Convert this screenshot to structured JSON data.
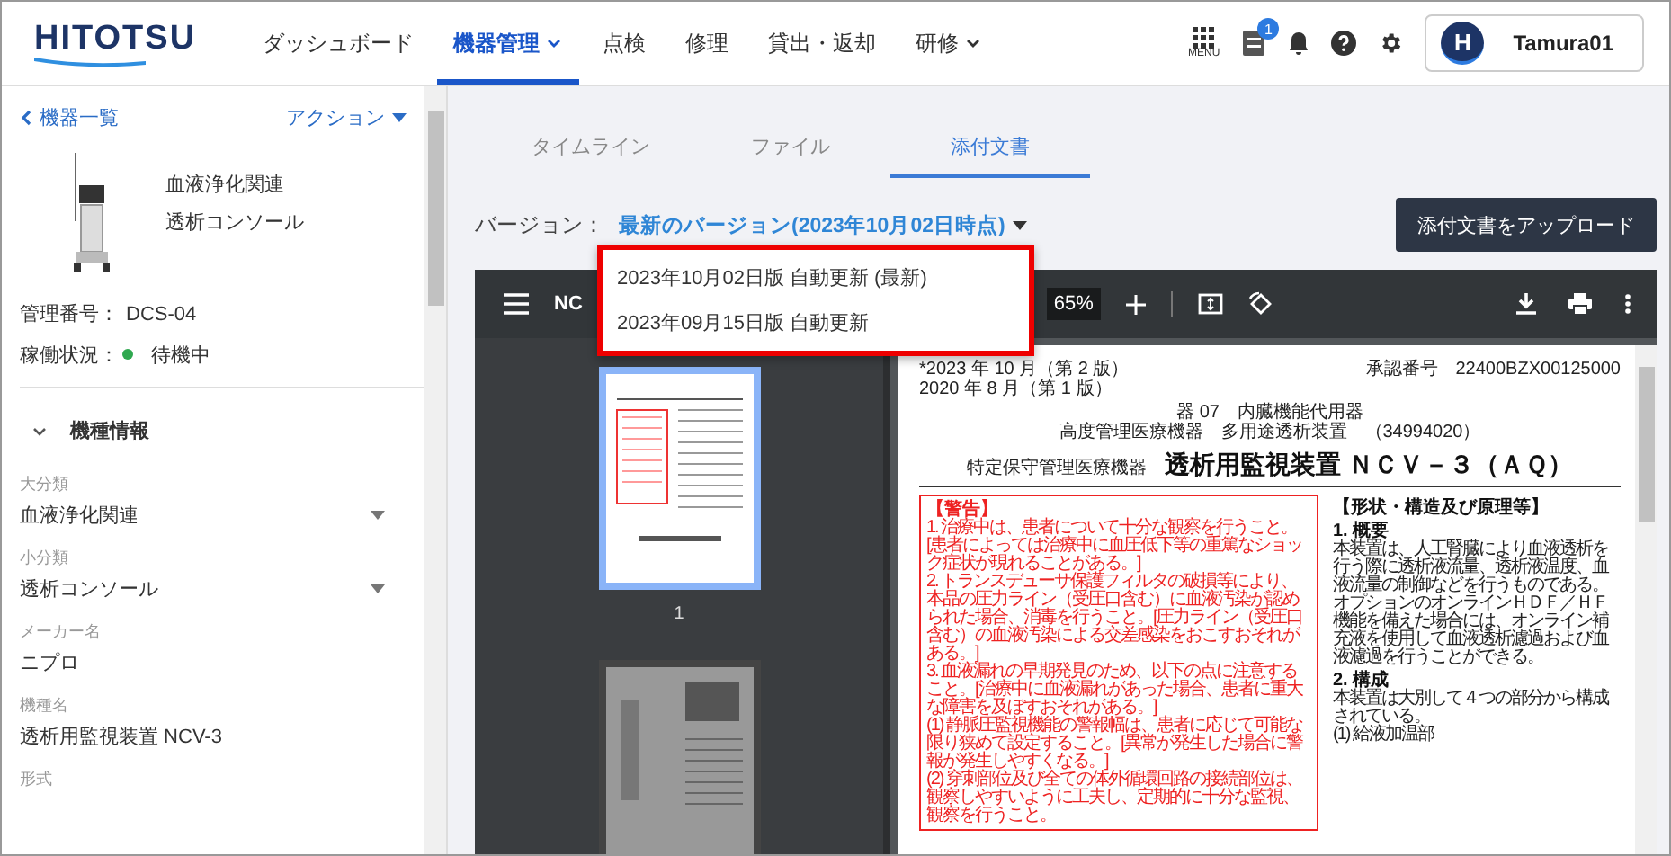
{
  "header": {
    "logo": "HITOTSU",
    "nav": [
      {
        "label": "ダッシュボード",
        "selected": false,
        "dropdown": false
      },
      {
        "label": "機器管理",
        "selected": true,
        "dropdown": true
      },
      {
        "label": "点検",
        "selected": false,
        "dropdown": false
      },
      {
        "label": "修理",
        "selected": false,
        "dropdown": false
      },
      {
        "label": "貸出・返却",
        "selected": false,
        "dropdown": false
      },
      {
        "label": "研修",
        "selected": false,
        "dropdown": true
      }
    ],
    "menu_label": "MENU",
    "notification_badge": "1",
    "user": {
      "initial": "H",
      "name": "Tamura01"
    }
  },
  "sidebar": {
    "back_link": "機器一覧",
    "action": "アクション",
    "device": {
      "category": "血液浄化関連",
      "type": "透析コンソール"
    },
    "info": [
      {
        "label": "管理番号：",
        "value": "DCS-04"
      },
      {
        "label": "稼働状況：",
        "value": "待機中",
        "color": "#2fa84f"
      }
    ],
    "section": {
      "title": "機種情報",
      "expanded": true
    },
    "fields": [
      {
        "kind": "select",
        "label": "大分類",
        "value": "血液浄化関連"
      },
      {
        "kind": "select",
        "label": "小分類",
        "value": "透析コンソール"
      },
      {
        "kind": "text",
        "label": "メーカー名",
        "value": "ニプロ"
      },
      {
        "kind": "text",
        "label": "機種名",
        "value": "透析用監視装置 NCV-3"
      },
      {
        "kind": "text",
        "label": "形式"
      }
    ]
  },
  "tabs": [
    {
      "label": "タイムライン",
      "selected": false
    },
    {
      "label": "ファイル",
      "selected": false
    },
    {
      "label": "添付文書",
      "selected": true
    }
  ],
  "version": {
    "label": "バージョン：",
    "value": "最新のバージョン(2023年10月02日時点)",
    "options": [
      "2023年10月02日版 自動更新 (最新)",
      "2023年09月15日版 自動更新"
    ]
  },
  "upload_button": "添付文書をアップロード",
  "viewer": {
    "title": "NC",
    "zoom": "65%",
    "thumbnails": [
      {
        "label": "1",
        "selected": true
      },
      {
        "selected": false
      }
    ],
    "page": {
      "revision": [
        "*2023 年 10 月（第 2 版）",
        "2020 年 8 月（第 1 版）"
      ],
      "approval": "承認番号　22400BZX00125000",
      "classification": [
        "器 07　内臓機能代用器",
        "高度管理医療機器　多用途透析装置　（34994020）"
      ],
      "title_prefix": "特定保守管理医療機器",
      "title": "透析用監視装置 ＮＣＶ－３（ＡＱ）",
      "warning": {
        "title": "【警告】",
        "items": [
          "1. 治療中は、患者について十分な観察を行うこと。[患者によっては治療中に血圧低下等の重篤なショック症状が現れることがある。]",
          "2. トランスデューサ保護フィルタの破損等により、本品の圧力ライン（受圧口含む）に血液汚染が認められた場合、消毒を行うこと。[圧力ライン（受圧口含む）の血液汚染による交差感染をおこすおそれがある。]",
          "3. 血液漏れの早期発見のため、以下の点に注意すること。[治療中に血液漏れがあった場合、患者に重大な障害を及ぼすおそれがある。]",
          "(1) 静脈圧監視機能の警報幅は、患者に応じて可能な限り狭めて設定すること。[異常が発生した場合に警報が発生しやすくなる。]",
          "(2) 穿刺部位及び全ての体外循環回路の接続部位は、観察しやすいように工夫し、定期的に十分な監視、観察を行うこと。"
        ]
      },
      "structure": {
        "title": "【形状・構造及び原理等】",
        "blocks": [
          {
            "kind": "heading",
            "text": "1. 概要"
          },
          {
            "kind": "para",
            "text": "本装置は、人工腎臓により血液透析を行う際に透析液流量、透析液温度、血液流量の制御などを行うものである。"
          },
          {
            "kind": "para",
            "text": "オプションのオンラインＨＤＦ／ＨＦ機能を備えた場合には、オンライン補充液を使用して血液透析濾過および血液濾過を行うことができる。"
          },
          {
            "kind": "heading",
            "text": "2. 構成"
          },
          {
            "kind": "para",
            "text": "本装置は大別して４つの部分から構成されている。"
          },
          {
            "kind": "para",
            "text": "(1) 給液加温部"
          }
        ]
      }
    }
  }
}
